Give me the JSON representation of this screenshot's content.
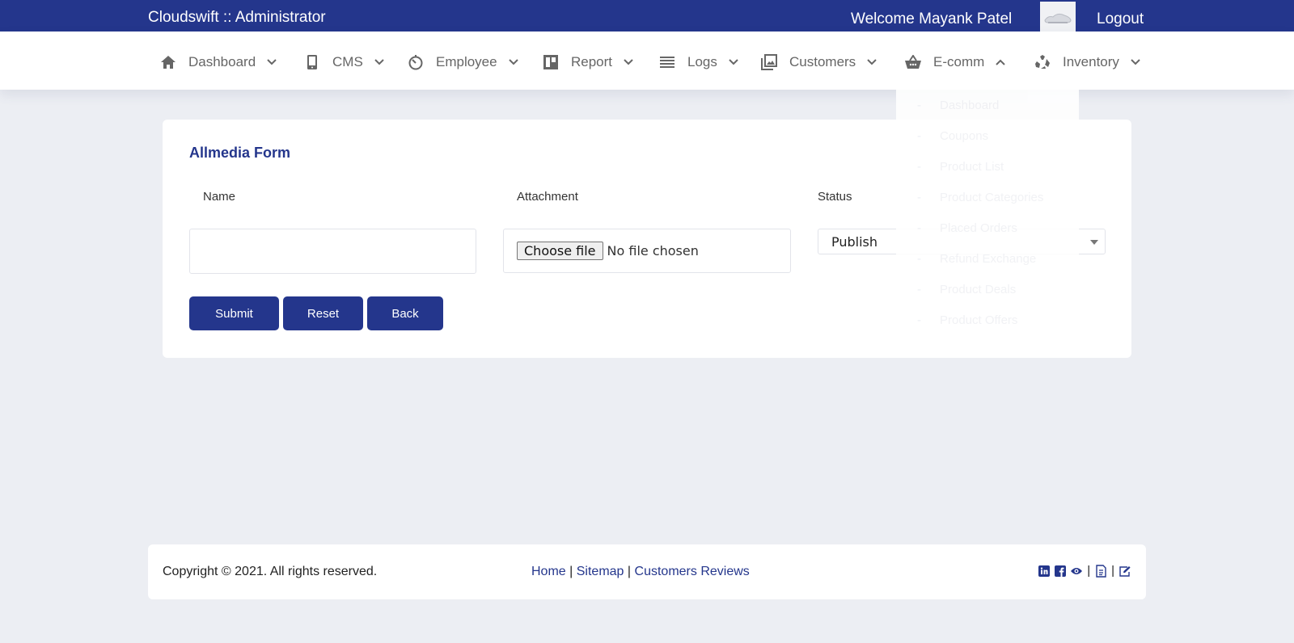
{
  "topbar": {
    "brand": "Cloudswift :: Administrator",
    "welcome": "Welcome Mayank Patel",
    "logout": "Logout"
  },
  "nav": {
    "items": [
      {
        "label": "Dashboard",
        "icon": "home-icon"
      },
      {
        "label": "CMS",
        "icon": "mobile-icon"
      },
      {
        "label": "Employee",
        "icon": "timer-icon"
      },
      {
        "label": "Report",
        "icon": "columns-icon"
      },
      {
        "label": "Logs",
        "icon": "list-icon"
      },
      {
        "label": "Customers",
        "icon": "image-icon"
      },
      {
        "label": "E-comm",
        "icon": "basket-icon",
        "expanded": true
      },
      {
        "label": "Inventory",
        "icon": "recycle-icon"
      }
    ],
    "ecomm_dropdown": [
      "Dashboard",
      "Coupons",
      "Product List",
      "Product Categories",
      "Placed Orders",
      "Refund Exchange",
      "Product Deals",
      "Product Offers"
    ]
  },
  "form": {
    "title": "Allmedia Form",
    "name_label": "Name",
    "name_value": "",
    "attachment_label": "Attachment",
    "file_button": "Choose file",
    "file_status": "No file chosen",
    "status_label": "Status",
    "status_value": "Publish",
    "buttons": {
      "submit": "Submit",
      "reset": "Reset",
      "back": "Back"
    }
  },
  "footer": {
    "copyright": "Copyright © 2021. All rights reserved.",
    "links": [
      "Home",
      "Sitemap",
      "Customers Reviews"
    ],
    "separator": "|",
    "icons": [
      "linkedin-icon",
      "facebook-icon",
      "eye-icon",
      "document-icon",
      "edit-icon"
    ]
  },
  "colors": {
    "primary": "#24368c",
    "background": "#eceef3"
  }
}
